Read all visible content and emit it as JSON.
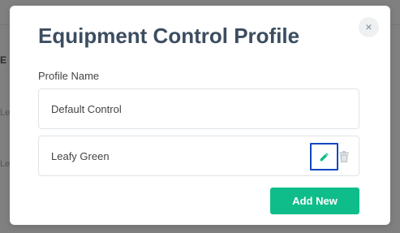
{
  "background": {
    "text_fragments": [
      "E",
      "Le",
      "Le"
    ]
  },
  "modal": {
    "title": "Equipment Control Profile",
    "close_symbol": "×",
    "field_label": "Profile Name",
    "profiles": [
      {
        "name": "Default Control"
      },
      {
        "name": "Leafy Green",
        "actions": [
          "pencil-icon",
          "trash-icon"
        ]
      }
    ],
    "add_button_label": "Add New"
  },
  "colors": {
    "title": "#3c4d60",
    "accent_green": "#0fbd8a",
    "edit_focus_border": "#1546c0",
    "icon_gray": "#c3c8ce"
  }
}
